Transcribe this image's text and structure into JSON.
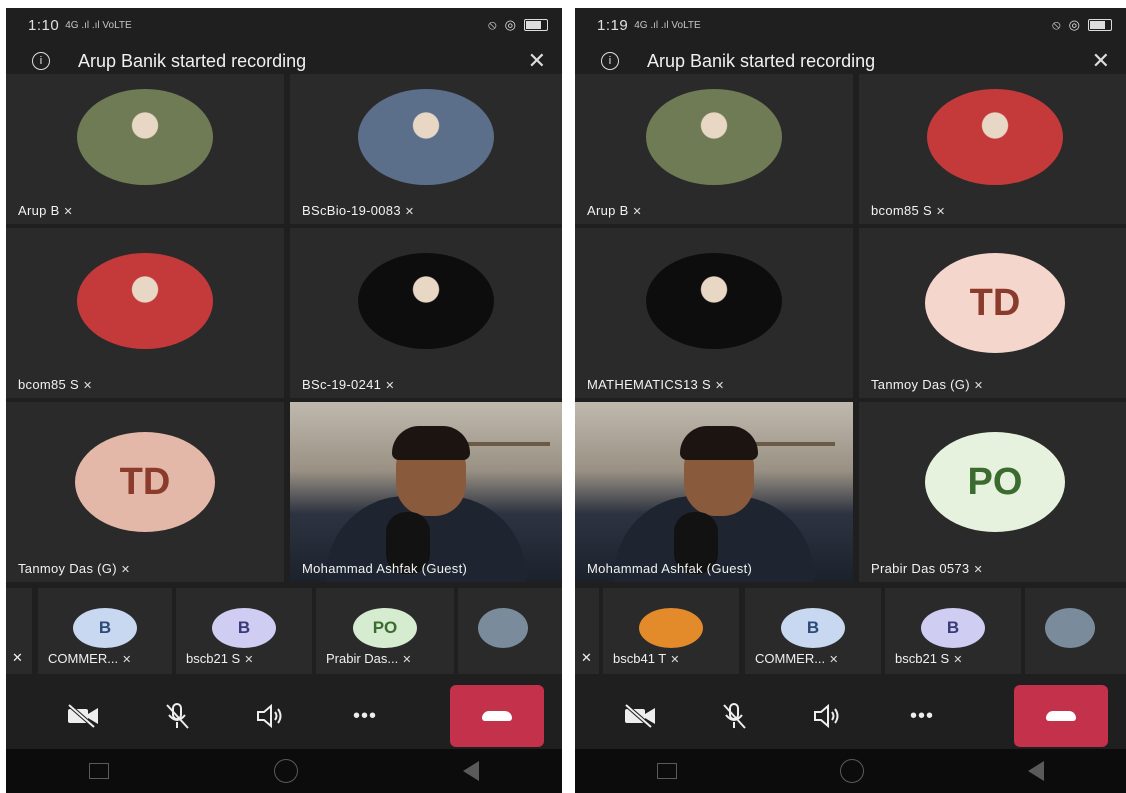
{
  "left": {
    "status": {
      "time": "1:10",
      "signal": "4G .ıl .ıl VoLTE"
    },
    "banner": {
      "text": "Arup Banik started recording"
    },
    "tiles": [
      {
        "name": "Arup B",
        "initials": "",
        "kind": "photo",
        "color": "#6f7b55"
      },
      {
        "name": "BScBio-19-0083",
        "initials": "",
        "kind": "photo",
        "color": "#5b6f8a"
      },
      {
        "name": "bcom85 S",
        "initials": "",
        "kind": "photo",
        "color": "#c43a3a"
      },
      {
        "name": "BSc-19-0241",
        "initials": "",
        "kind": "photo",
        "color": "#0d0d0d"
      },
      {
        "name": "Tanmoy Das (G)",
        "initials": "TD",
        "kind": "initials",
        "color": "#e3b8a8",
        "text_color": "#8a3b2b"
      },
      {
        "name": "Mohammad Ashfak (Guest)",
        "initials": "",
        "kind": "video",
        "color": ""
      }
    ],
    "strip": [
      {
        "name": "",
        "initials": "",
        "color": ""
      },
      {
        "name": "COMMER...",
        "initials": "B",
        "color": "#c8d8f0",
        "text_color": "#2c4a7a"
      },
      {
        "name": "bscb21 S",
        "initials": "B",
        "color": "#cfcdf2",
        "text_color": "#3a3a7a"
      },
      {
        "name": "Prabir Das...",
        "initials": "PO",
        "color": "#d6ecd0",
        "text_color": "#3b6b2e"
      },
      {
        "name": "",
        "initials": "",
        "color": "#7a8c9c"
      }
    ]
  },
  "right": {
    "status": {
      "time": "1:19",
      "signal": "4G .ıl .ıl VoLTE"
    },
    "banner": {
      "text": "Arup Banik started recording"
    },
    "tiles": [
      {
        "name": "Arup B",
        "initials": "",
        "kind": "photo",
        "color": "#6f7b55"
      },
      {
        "name": "bcom85 S",
        "initials": "",
        "kind": "photo",
        "color": "#c43a3a"
      },
      {
        "name": "MATHEMATICS13 S",
        "initials": "",
        "kind": "photo",
        "color": "#0d0d0d"
      },
      {
        "name": "Tanmoy Das (G)",
        "initials": "TD",
        "kind": "initials",
        "color": "#f4d6cc",
        "text_color": "#8a3b2b"
      },
      {
        "name": "Mohammad Ashfak (Guest)",
        "initials": "",
        "kind": "video",
        "color": ""
      },
      {
        "name": "Prabir Das 0573",
        "initials": "PO",
        "kind": "initials",
        "color": "#e6f2de",
        "text_color": "#3b6b2e"
      }
    ],
    "strip": [
      {
        "name": "",
        "initials": "",
        "color": ""
      },
      {
        "name": "bscb41 T",
        "initials": "",
        "color": "#e38a2a"
      },
      {
        "name": "COMMER...",
        "initials": "B",
        "color": "#c8d8f0",
        "text_color": "#2c4a7a"
      },
      {
        "name": "bscb21 S",
        "initials": "B",
        "color": "#cfcdf2",
        "text_color": "#3a3a7a"
      },
      {
        "name": "",
        "initials": "",
        "color": "#7a8c9c"
      }
    ]
  },
  "icons": {
    "info": "i",
    "close": "✕",
    "mute": "🔇",
    "camera_off": "camera-off-icon",
    "mic_off": "mic-off-icon",
    "speaker": "speaker-icon",
    "more": "•••",
    "end_call": "end-call-icon"
  },
  "colors": {
    "end_call": "#c4314b",
    "background": "#1f1f1f"
  }
}
